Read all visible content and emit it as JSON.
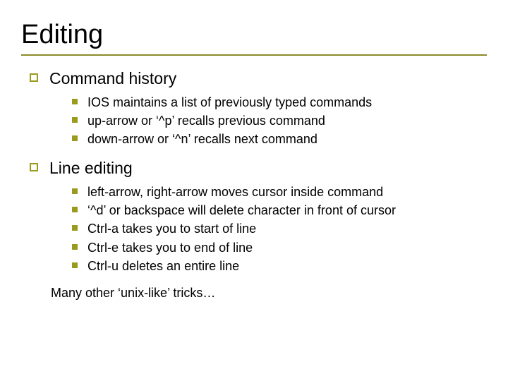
{
  "slide": {
    "title": "Editing",
    "sections": [
      {
        "heading": "Command history",
        "items": [
          "IOS maintains a list of previously typed commands",
          "up-arrow or ‘^p’ recalls previous command",
          "down-arrow or ‘^n’ recalls next command"
        ]
      },
      {
        "heading": "Line editing",
        "items": [
          "left-arrow, right-arrow moves cursor inside command",
          "‘^d’ or backspace will delete character in front of cursor",
          "Ctrl-a takes you to start of line",
          "Ctrl-e takes you to end of line",
          "Ctrl-u deletes an entire line"
        ]
      }
    ],
    "footer": "Many other ‘unix-like’ tricks…"
  },
  "colors": {
    "accent": "#9a9a1e"
  }
}
